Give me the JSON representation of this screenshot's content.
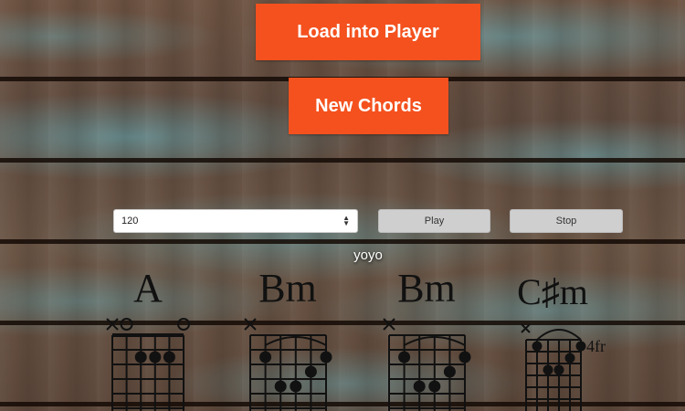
{
  "controls": {
    "load_label": "Load into Player",
    "new_label": "New Chords",
    "tempo_value": "120",
    "play_label": "Play",
    "stop_label": "Stop"
  },
  "song": {
    "title": "yoyo"
  },
  "chords": [
    {
      "name": "A",
      "fret_label": ""
    },
    {
      "name": "Bm",
      "fret_label": ""
    },
    {
      "name": "Bm",
      "fret_label": ""
    },
    {
      "name": "C♯m",
      "fret_label": "4fr"
    }
  ],
  "colors": {
    "accent": "#f4511e",
    "secondary_button": "#cfcfcf"
  }
}
